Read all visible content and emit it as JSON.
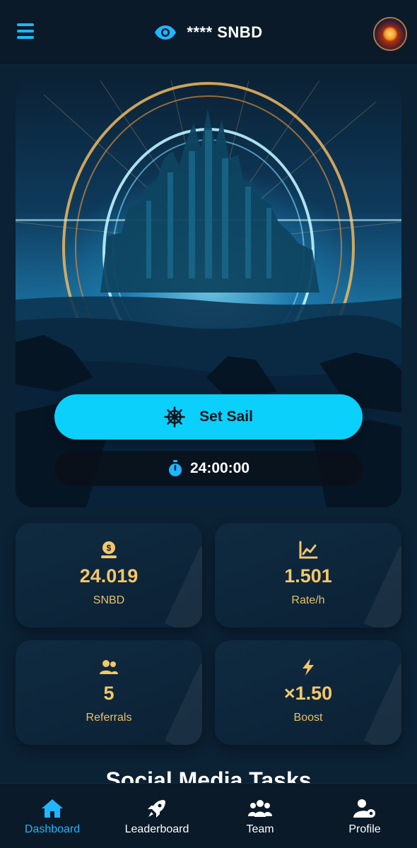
{
  "header": {
    "balance_masked": "**** SNBD",
    "logo_alt": "SINBAD NETWORK"
  },
  "hero": {
    "set_sail_label": "Set Sail",
    "timer": "24:00:00"
  },
  "stats": [
    {
      "icon": "coin-icon",
      "value": "24.019",
      "label": "SNBD"
    },
    {
      "icon": "chart-line-icon",
      "value": "1.501",
      "label": "Rate/h"
    },
    {
      "icon": "users-icon",
      "value": "5",
      "label": "Referrals"
    },
    {
      "icon": "bolt-icon",
      "value": "×1.50",
      "label": "Boost"
    }
  ],
  "section": {
    "title": "Social Media Tasks"
  },
  "nav": [
    {
      "icon": "home-icon",
      "label": "Dashboard",
      "active": true
    },
    {
      "icon": "rocket-icon",
      "label": "Leaderboard",
      "active": false
    },
    {
      "icon": "team-icon",
      "label": "Team",
      "active": false
    },
    {
      "icon": "user-gear-icon",
      "label": "Profile",
      "active": false
    }
  ],
  "colors": {
    "accent": "#0ad0fb",
    "gold": "#f3c76b",
    "background": "#0b2134"
  }
}
